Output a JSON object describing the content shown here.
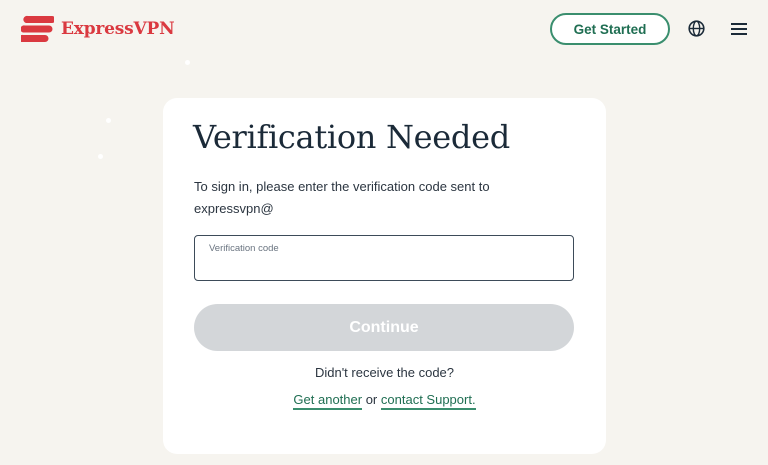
{
  "header": {
    "brand_name": "ExpressVPN",
    "brand_color": "#da3940",
    "get_started_label": "Get Started",
    "icons": [
      "expressvpn-logo-icon",
      "globe-icon",
      "hamburger-menu-icon"
    ]
  },
  "card": {
    "title": "Verification Needed",
    "instruction_line1": "To sign in, please enter the verification code sent to",
    "instruction_line2": "expressvpn@",
    "input": {
      "label": "Verification code",
      "value": ""
    },
    "continue_label": "Continue",
    "continue_enabled": false,
    "no_code_text": "Didn't receive the code?",
    "get_another_label": "Get another",
    "or_text": "or",
    "contact_support_label": "contact Support."
  },
  "colors": {
    "background": "#f6f4ef",
    "card": "#ffffff",
    "accent_green": "#3a8e6e",
    "button_disabled": "#d3d6d9"
  }
}
